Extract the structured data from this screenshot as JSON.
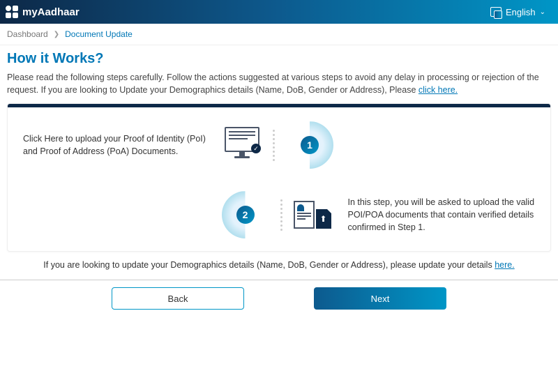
{
  "header": {
    "app_name": "myAadhaar",
    "language": "English"
  },
  "breadcrumb": {
    "root": "Dashboard",
    "current": "Document Update"
  },
  "page": {
    "title": "How it Works?",
    "intro_prefix": "Please read the following steps carefully. Follow the actions suggested at various steps to avoid any delay in processing or rejection of the request. If you are looking to Update your Demographics details (Name, DoB, Gender or Address), Please ",
    "intro_link": "click here."
  },
  "steps": {
    "step1": {
      "number": "1",
      "text": "Click Here to upload your Proof of Identity (PoI) and Proof of Address (PoA) Documents."
    },
    "step2": {
      "number": "2",
      "text": "In this step, you will be asked to upload the valid POI/POA documents that contain verified details confirmed in Step 1."
    }
  },
  "footer": {
    "note_prefix": "If you are looking to update your Demographics details (Name, DoB, Gender or Address), please update your details ",
    "note_link": "here."
  },
  "buttons": {
    "back": "Back",
    "next": "Next"
  }
}
